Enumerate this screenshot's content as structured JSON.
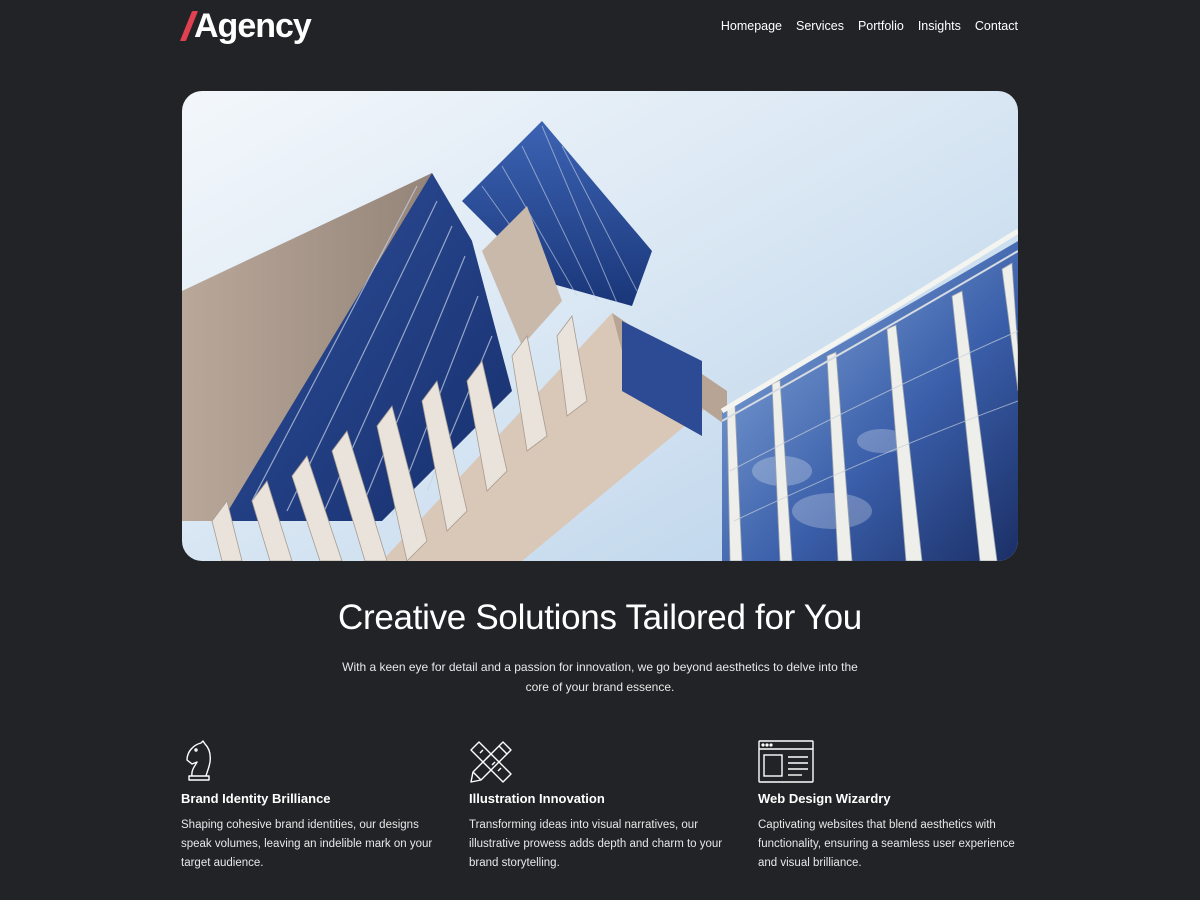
{
  "header": {
    "logo_text": "Agency",
    "logo_accent_color": "#e0404f",
    "nav": [
      {
        "label": "Homepage"
      },
      {
        "label": "Services"
      },
      {
        "label": "Portfolio"
      },
      {
        "label": "Insights"
      },
      {
        "label": "Contact"
      }
    ]
  },
  "hero": {
    "image_icon": "hero-building-image"
  },
  "main": {
    "headline": "Creative Solutions Tailored for You",
    "intro": "With a keen eye for detail and a passion for innovation, we go beyond aesthetics to delve into the core of your brand essence."
  },
  "features": [
    {
      "icon": "chess-knight-icon",
      "title": "Brand Identity Brilliance",
      "text": "Shaping cohesive brand identities, our designs speak volumes, leaving an indelible mark on your target audience."
    },
    {
      "icon": "pencil-ruler-icon",
      "title": "Illustration Innovation",
      "text": "Transforming ideas into visual narratives, our illustrative prowess adds depth and charm to your brand storytelling."
    },
    {
      "icon": "browser-layout-icon",
      "title": "Web Design Wizardry",
      "text": "Captivating websites that blend aesthetics with functionality, ensuring a seamless user experience and visual brilliance."
    }
  ],
  "colors": {
    "background": "#212326",
    "text": "#ffffff",
    "accent": "#e0404f"
  }
}
